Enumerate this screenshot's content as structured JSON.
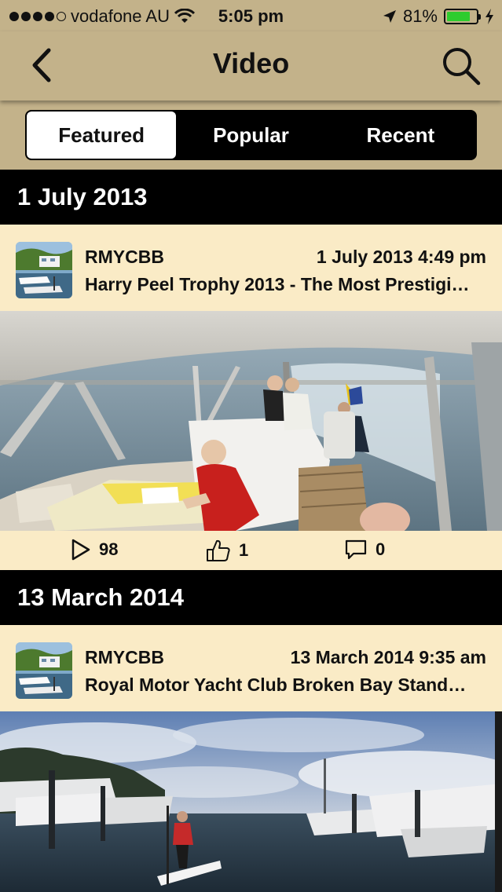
{
  "status_bar": {
    "carrier": "vodafone AU",
    "time": "5:05 pm",
    "battery": "81%",
    "battery_level": 0.81,
    "signal_bars": 4,
    "signal_max": 5
  },
  "nav": {
    "title": "Video",
    "back_icon": "chevron-left-icon",
    "search_icon": "search-icon"
  },
  "tabs": [
    {
      "label": "Featured",
      "active": true
    },
    {
      "label": "Popular",
      "active": false
    },
    {
      "label": "Recent",
      "active": false
    }
  ],
  "sections": [
    {
      "date": "1 July 2013",
      "author": "RMYCBB",
      "posted": "1 July 2013 4:49 pm",
      "title": "Harry Peel Trophy 2013 - The Most Prestigi…",
      "views": "98",
      "likes": "1",
      "comments": "0"
    },
    {
      "date": "13 March 2014",
      "author": "RMYCBB",
      "posted": "13 March 2014 9:35 am",
      "title": "Royal Motor Yacht Club Broken Bay Stand…"
    }
  ],
  "colors": {
    "nav_background": "#c3b28a",
    "card_background": "#faebc6",
    "header_background": "#000000",
    "battery_green": "#2ecc2e"
  }
}
